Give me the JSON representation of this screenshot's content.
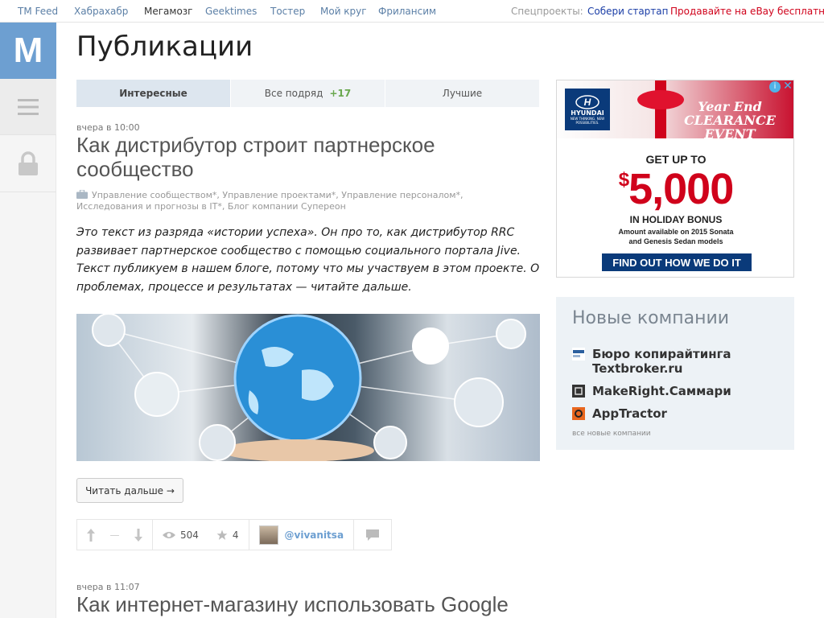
{
  "topbar": {
    "links": [
      "TM Feed",
      "Хабрахабр",
      "Мегамозг",
      "Geektimes",
      "Тостер",
      "Мой круг",
      "Фрилансим"
    ],
    "special_label": "Спецпроекты:",
    "special1": "Собери стартап",
    "special2": "Продавайте на eBay бесплатно"
  },
  "logo": {
    "text": "M",
    "color": "#6d9fd1"
  },
  "page": {
    "title": "Публикации"
  },
  "tabs": [
    {
      "label": "Интересные"
    },
    {
      "label": "Все подряд",
      "count": "+17"
    },
    {
      "label": "Лучшие"
    }
  ],
  "post": {
    "time": "вчера в 10:00",
    "title": "Как дистрибутор строит партнерское сообщество",
    "hubs": "Управление сообществом*, Управление проектами*, Управление персоналом*, Исследования и прогнозы в IT*, Блог компании Супереон",
    "excerpt": "Это текст из разряда «истории успеха». Он про то, как дистрибутор RRC развивает партнерское сообщество с помощью социального портала Jive. Текст публикуем в нашем блоге, потому что мы участвуем в этом проекте. О проблемах, процессе и результатах — читайте дальше.",
    "read_more": "Читать дальше →",
    "score": "—",
    "views": "504",
    "favorites": "4",
    "author": "@vivanitsa"
  },
  "post2": {
    "time": "вчера в 11:07",
    "title": "Как интернет-магазину использовать Google"
  },
  "ad": {
    "brand": "HYUNDAI",
    "tagline": "NEW THINKING. NEW POSSIBILITIES.",
    "banner": "Year End CLEARANCE EVENT",
    "headline": "GET UP TO",
    "amount": "5,000",
    "currency": "$",
    "bonus": "IN HOLIDAY BONUS",
    "fine1": "Amount available on 2015 Sonata",
    "fine2": "and Genesis Sedan models",
    "cta": "FIND OUT HOW WE DO IT"
  },
  "companies": {
    "title": "Новые компании",
    "items": [
      {
        "name": "Бюро копирайтинга Textbroker.ru",
        "icon": "textbroker-icon"
      },
      {
        "name": "MakeRight.Саммари",
        "icon": "makeright-icon"
      },
      {
        "name": "AppTractor",
        "icon": "apptractor-icon"
      }
    ],
    "all_link": "все новые компании"
  }
}
